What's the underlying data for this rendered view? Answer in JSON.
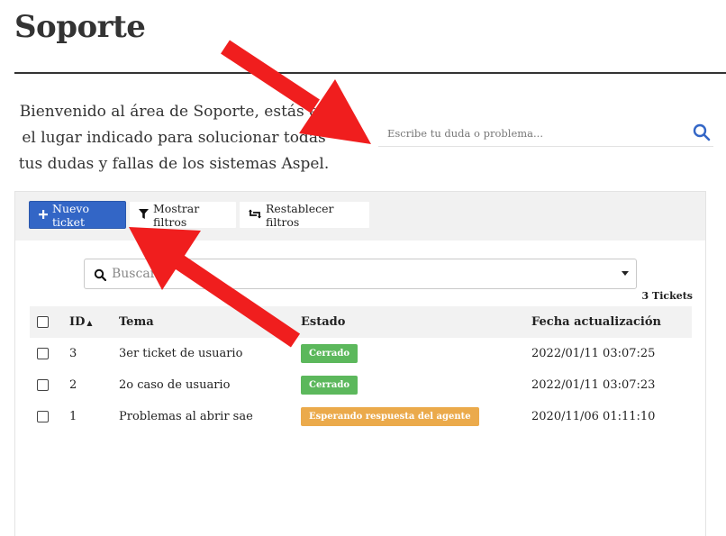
{
  "page": {
    "title": "Soporte",
    "welcome_text": "Bienvenido al área de Soporte, estás en el lugar indicado para solucionar todas tus dudas y fallas de los sistemas Aspel."
  },
  "help_search": {
    "placeholder": "Escribe tu duda o problema...",
    "icon": "search-icon"
  },
  "toolbar": {
    "new_ticket_label": "Nuevo ticket",
    "show_filters_label": "Mostrar filtros",
    "reset_filters_label": "Restablecer filtros"
  },
  "ticket_search": {
    "placeholder": "Buscar"
  },
  "ticket_count": "3 Tickets",
  "table": {
    "headers": {
      "id": "ID",
      "tema": "Tema",
      "estado": "Estado",
      "fecha": "Fecha actualización"
    },
    "rows": [
      {
        "id": "3",
        "tema": "3er ticket de usuario",
        "estado": "Cerrado",
        "fecha": "2022/01/11 03:07:25"
      },
      {
        "id": "2",
        "tema": "2o caso de usuario",
        "estado": "Cerrado",
        "fecha": "2022/01/11 03:07:23"
      },
      {
        "id": "1",
        "tema": "Problemas al abrir sae",
        "estado": "Esperando respuesta del agente",
        "fecha": "2020/11/06 01:11:10"
      }
    ]
  },
  "colors": {
    "primary": "#3366c6",
    "status_closed": "#5cb85c",
    "status_waiting": "#ebaa4b",
    "annotation_arrow": "#f01e1e"
  }
}
